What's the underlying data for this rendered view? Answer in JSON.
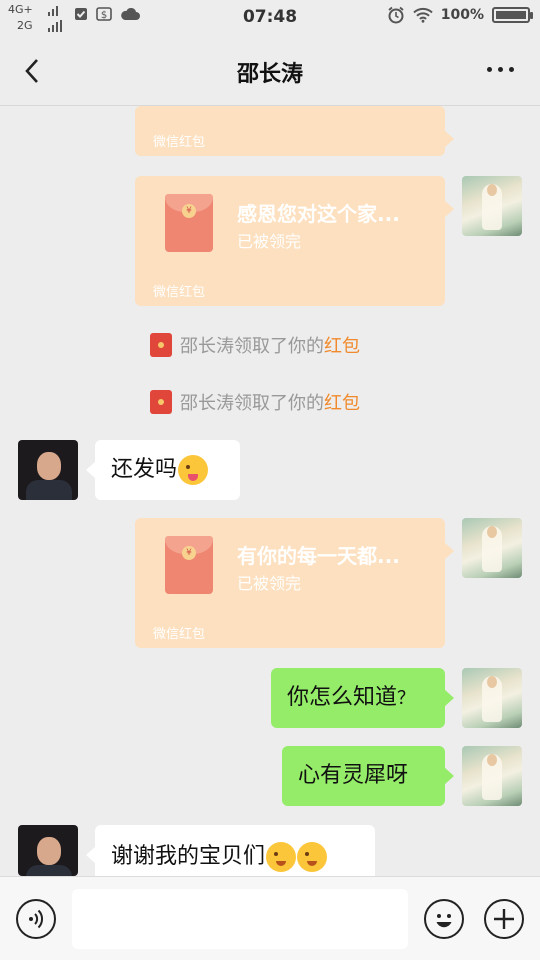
{
  "status_bar": {
    "network_top": "4G+",
    "network_bottom": "2G",
    "time": "07:48",
    "battery": "100%"
  },
  "header": {
    "title": "邵长涛"
  },
  "messages": [
    {
      "type": "redpacket",
      "from": "me",
      "footer": "微信红包"
    },
    {
      "type": "redpacket",
      "from": "me",
      "title": "感恩您对这个家...",
      "status": "已被领完",
      "footer": "微信红包"
    },
    {
      "type": "system",
      "prefix": "邵长涛领取了你的",
      "highlight": "红包"
    },
    {
      "type": "system",
      "prefix": "邵长涛领取了你的",
      "highlight": "红包"
    },
    {
      "type": "text",
      "from": "other",
      "text": "还发吗",
      "emoji": "winking-tongue-emoji"
    },
    {
      "type": "redpacket",
      "from": "me",
      "title": "有你的每一天都...",
      "status": "已被领完",
      "footer": "微信红包"
    },
    {
      "type": "text",
      "from": "me",
      "text": "你怎么知道",
      "suffix": "？"
    },
    {
      "type": "text",
      "from": "me",
      "text": "心有灵犀呀"
    },
    {
      "type": "text",
      "from": "other",
      "text": "谢谢我的宝贝们",
      "emoji": "kissing-emoji"
    }
  ],
  "colors": {
    "background": "#ededed",
    "bubble_me": "#95ec69",
    "bubble_other": "#ffffff",
    "red_packet": "#fde0bf",
    "highlight": "#f08a2c"
  },
  "icons": {
    "back": "chevron-left-icon",
    "more": "more-dots-icon",
    "voice": "voice-icon",
    "emoji": "emoji-icon",
    "plus": "plus-icon"
  }
}
